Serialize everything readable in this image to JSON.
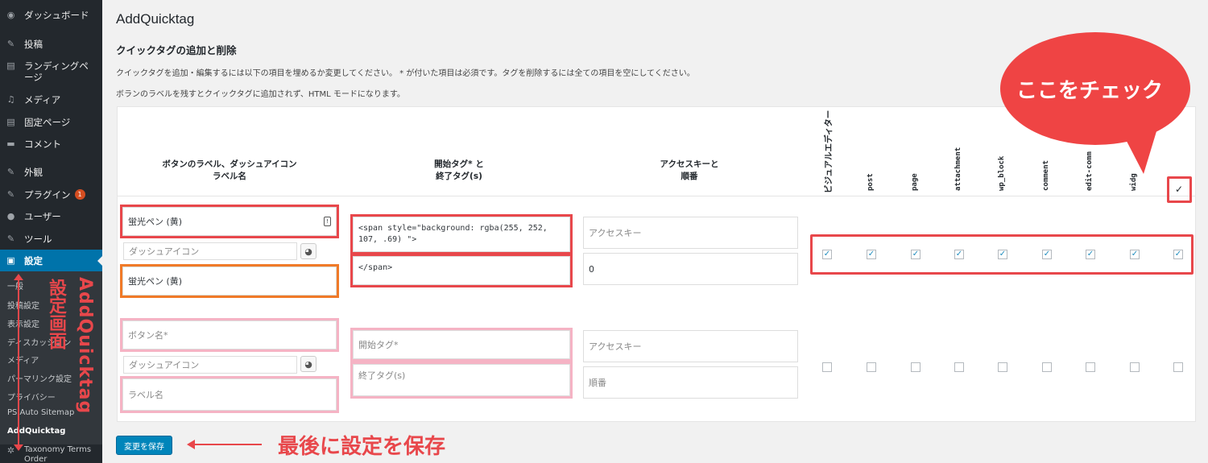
{
  "sidebar": {
    "items": [
      {
        "label": "ダッシュボード",
        "icon": "dashboard-icon",
        "glyph": "◉"
      },
      {
        "label": "投稿",
        "icon": "pin-icon",
        "glyph": "✎"
      },
      {
        "label": "ランディングページ",
        "icon": "page-icon",
        "glyph": "▤"
      },
      {
        "label": "メディア",
        "icon": "media-icon",
        "glyph": "♫"
      },
      {
        "label": "固定ページ",
        "icon": "page-icon",
        "glyph": "▤"
      },
      {
        "label": "コメント",
        "icon": "comment-icon",
        "glyph": "▬"
      },
      {
        "label": "外観",
        "icon": "appearance-icon",
        "glyph": "✎"
      },
      {
        "label": "プラグイン",
        "icon": "plugin-icon",
        "glyph": "✎",
        "badge": "1"
      },
      {
        "label": "ユーザー",
        "icon": "user-icon",
        "glyph": "●"
      },
      {
        "label": "ツール",
        "icon": "tool-icon",
        "glyph": "✎"
      },
      {
        "label": "設定",
        "icon": "settings-icon",
        "glyph": "▣"
      }
    ],
    "submenu": [
      "一般",
      "投稿設定",
      "表示設定",
      "ディスカッション",
      "メディア",
      "パーマリンク設定",
      "プライバシー",
      "PS Auto Sitemap",
      "AddQuicktag",
      "Taxonomy Terms Order"
    ]
  },
  "page": {
    "title": "AddQuicktag",
    "section_title": "クイックタグの追加と削除",
    "desc1": "クイックタグを追加・編集するには以下の項目を埋めるか変更してください。 * が付いた項目は必須です。タグを削除するには全ての項目を空にしてください。",
    "desc2": "ボランのラベルを残すとクイックタグに追加されず、HTML モードになります。"
  },
  "table": {
    "headers": {
      "label_col": "ボタンのラベル、ダッシュアイコン",
      "label_col2": "ラベル名",
      "tag_col": "開始タグ* と",
      "tag_col2": "終了タグ(s)",
      "access_col": "アクセスキーと",
      "access_col2": "順番",
      "visual": "ビジュアルエディター",
      "post_types": [
        "post",
        "page",
        "attachment",
        "wp_block",
        "comment",
        "edit-comm",
        "widg"
      ],
      "check_all": "✓"
    },
    "row1": {
      "button_label": "蛍光ペン (黄)",
      "dashicon_placeholder": "ダッシュアイコン",
      "label_name": "蛍光ペン (黄)",
      "start_tag": "<span style=\"background: rgba(255, 252, 107, .69) \">",
      "end_tag": "</span>",
      "access_key_placeholder": "アクセスキー",
      "order": "0"
    },
    "row2": {
      "button_placeholder": "ボタン名*",
      "dashicon_placeholder": "ダッシュアイコン",
      "label_placeholder": "ラベル名",
      "start_placeholder": "開始タグ*",
      "end_placeholder": "終了タグ(s)",
      "access_key_placeholder": "アクセスキー",
      "order_placeholder": "順番"
    },
    "check_glyph": "✓"
  },
  "save_label": "変更を保存",
  "annotations": {
    "bubble": "ここをチェック",
    "save_note": "最後に設定を保存",
    "side_vertical": "AddQuicktag",
    "side_vertical2": "設定画面"
  },
  "colors": {
    "accent": "#0073aa",
    "highlight": "#e8474b",
    "orange": "#f07a28",
    "pink": "#f5b3c4"
  }
}
